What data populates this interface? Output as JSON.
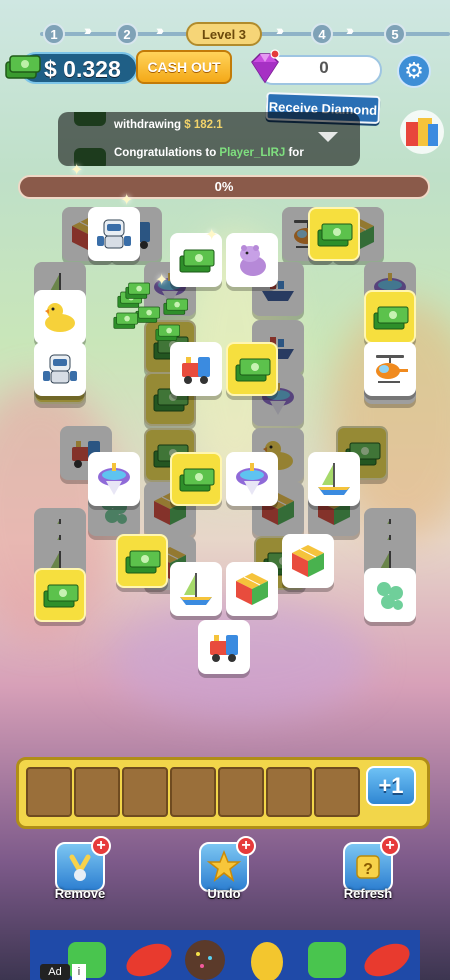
{
  "level_bar": {
    "steps": [
      "1",
      "2",
      "3",
      "4",
      "5"
    ],
    "current_label": "Level 3"
  },
  "wallet": {
    "balance": "$ 0.328",
    "cash_out_label": "CASH OUT"
  },
  "diamonds": {
    "count": "0",
    "receive_label": "Receive Diamond"
  },
  "ticker": {
    "line1_prefix": "withdrawing ",
    "line1_amount": "$ 182.1",
    "line2_prefix": "Congratulations to ",
    "line2_player": "Player_LIRJ",
    "line2_suffix": " for"
  },
  "progress": {
    "value_percent": 0,
    "label": "0%"
  },
  "tray": {
    "slot_count": 7,
    "plus_label": "+1"
  },
  "tools": {
    "remove_label": "Remove",
    "undo_label": "Undo",
    "refresh_label": "Refresh"
  },
  "ad": {
    "badge": "Ad",
    "info": "i"
  },
  "colors": {
    "tray": "#f2d64a",
    "tool_button": "#2d7fd1",
    "cash_out": "#f4a918"
  },
  "icons": [
    "money-stack-icon",
    "diamond-icon",
    "gear-icon",
    "book-icon",
    "duck-icon",
    "robot-icon",
    "hippo-icon",
    "train-icon",
    "top-icon",
    "sailboat-icon",
    "cube-icon",
    "balloon-dog-icon",
    "helicopter-icon",
    "ship-icon"
  ]
}
